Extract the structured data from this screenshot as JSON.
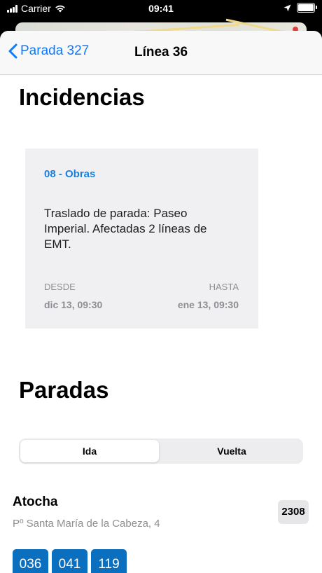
{
  "status_bar": {
    "carrier": "Carrier",
    "time": "09:41"
  },
  "nav": {
    "back_label": "Parada 327",
    "title": "Línea 36"
  },
  "incidents": {
    "title": "Incidencias",
    "category": "08 - Obras",
    "text": "Traslado de parada: Paseo Imperial. Afectadas 2 líneas de EMT.",
    "from_label": "DESDE",
    "from_value": "dic 13, 09:30",
    "to_label": "HASTA",
    "to_value": "ene 13, 09:30"
  },
  "stops": {
    "title": "Paradas",
    "segments": [
      "Ida",
      "Vuelta"
    ],
    "selected_segment": "Ida",
    "stop": {
      "name": "Atocha",
      "address": "Pº Santa María de la Cabeza, 4",
      "code": "2308",
      "lines": [
        "036",
        "041",
        "119"
      ]
    }
  },
  "colors": {
    "accent": "#0a7aff",
    "category": "#1a7fe0",
    "line_badge": "#0b6fbf"
  }
}
